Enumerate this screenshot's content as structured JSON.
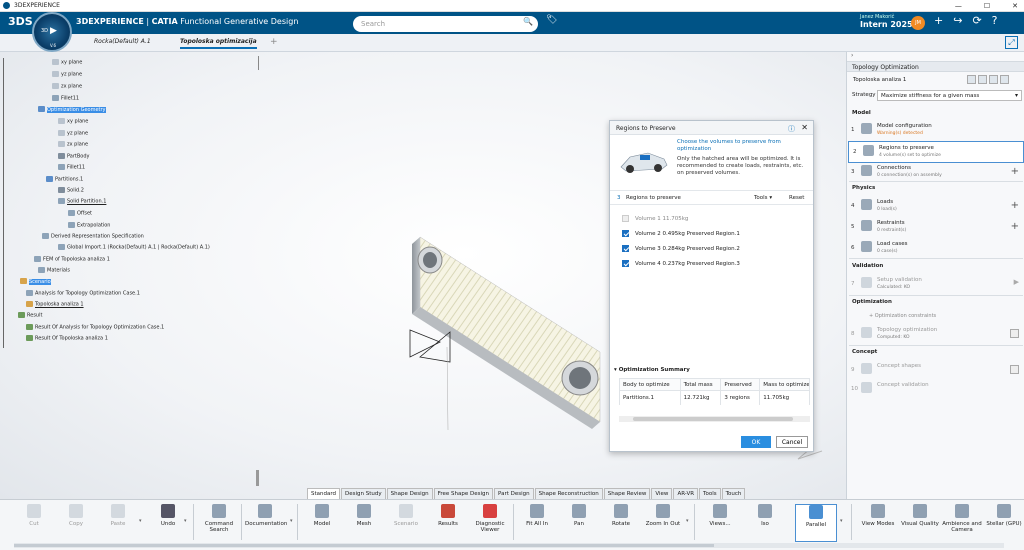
{
  "window": {
    "title": "3DEXPERIENCE",
    "controls": [
      "—",
      "☐",
      "✕"
    ]
  },
  "topbar": {
    "brand_left": "3DEXPERIENCE",
    "brand_sep": " | ",
    "brand_app_bold": "CATIA",
    "brand_app": " Functional Generative Design",
    "search_placeholder": "Search",
    "user_name": "Janez Makorič",
    "tenant": "Intern 2025",
    "avatar_initials": "JM"
  },
  "compass": {
    "label": "3D",
    "version": "V.6"
  },
  "tabs": [
    {
      "label": "Rocka(Default) A.1",
      "active": false
    },
    {
      "label": "Topoloska optimizacija",
      "active": true
    }
  ],
  "tree": [
    {
      "label": "xy plane",
      "icon": "plane"
    },
    {
      "label": "yz plane",
      "icon": "plane"
    },
    {
      "label": "zx plane",
      "icon": "plane"
    },
    {
      "label": "Fillet11",
      "icon": "feature"
    },
    {
      "label": "Optimization Geometry",
      "icon": "geometry",
      "selected": true
    },
    {
      "label": "xy plane",
      "icon": "plane"
    },
    {
      "label": "yz plane",
      "icon": "plane"
    },
    {
      "label": "zx plane",
      "icon": "plane"
    },
    {
      "label": "PartBody",
      "icon": "body"
    },
    {
      "label": "Fillet11",
      "icon": "feature"
    },
    {
      "label": "Partitions.1",
      "icon": "geometry"
    },
    {
      "label": "Solid.2",
      "icon": "body"
    },
    {
      "label": "Solid Partition.1",
      "icon": "feature"
    },
    {
      "label": "Offset",
      "icon": "feature"
    },
    {
      "label": "Extrapolation",
      "icon": "feature"
    },
    {
      "label": "Derived Representation Specification",
      "icon": "feature"
    },
    {
      "label": "Global Import.1 (Rocka(Default) A.1 | Rocka(Default) A.1)",
      "icon": "feature"
    },
    {
      "label": "FEM of Topoloska analiza 1",
      "icon": "feature"
    },
    {
      "label": "Materials",
      "icon": "feature"
    },
    {
      "label": "Scenario",
      "icon": "scenario",
      "selected": true
    },
    {
      "label": "Analysis for Topology Optimization Case.1",
      "icon": "feature"
    },
    {
      "label": "Topoloska analiza 1",
      "icon": "scenario"
    },
    {
      "label": "Result",
      "icon": "result"
    },
    {
      "label": "Result Of Analysis for Topology Optimization Case.1",
      "icon": "result"
    },
    {
      "label": "Result Of Topoloska analiza 1",
      "icon": "result"
    }
  ],
  "dialog": {
    "title": "Regions to Preserve",
    "intro_heading": "Choose the volumes to preserve from optimization",
    "intro_text": "Only the hatched area will be optimized. It is recommended to create loads, restraints, etc. on preserved volumes.",
    "regions_count": "3",
    "regions_label": "Regions to preserve",
    "tools_label": "Tools",
    "reset_label": "Reset",
    "volumes": [
      {
        "label": "Volume 1  11.705kg",
        "checked": false
      },
      {
        "label": "Volume 2  0.495kg   Preserved Region.1",
        "checked": true
      },
      {
        "label": "Volume 3  0.284kg   Preserved Region.2",
        "checked": true
      },
      {
        "label": "Volume 4  0.237kg   Preserved Region.3",
        "checked": true
      }
    ],
    "summary_title": "Optimization Summary",
    "summary_headers": [
      "Body to optimize",
      "Total mass",
      "Preserved",
      "Mass to optimize"
    ],
    "summary_row": [
      "Partitions.1",
      "12.721kg",
      "3 regions",
      "11.705kg"
    ],
    "ok": "OK",
    "cancel": "Cancel"
  },
  "panel": {
    "title": "Topology Optimization",
    "analysis": "Topoloska analiza 1",
    "strategy_label": "Strategy",
    "strategy_value": "Maximize stiffness for a given mass",
    "sections": {
      "model": "Model",
      "physics": "Physics",
      "validation": "Validation",
      "optimization": "Optimization",
      "concept": "Concept"
    },
    "steps": {
      "s1": {
        "num": "1",
        "title": "Model configuration",
        "sub": "Warning(s) detected"
      },
      "s2": {
        "num": "2",
        "title": "Regions to preserve",
        "sub": "4 volume(s) set to optimize"
      },
      "s3": {
        "num": "3",
        "title": "Connections",
        "sub": "0 connection(s) on assembly"
      },
      "s4": {
        "num": "4",
        "title": "Loads",
        "sub": "0 load(s)"
      },
      "s5": {
        "num": "5",
        "title": "Restraints",
        "sub": "0 restraint(s)"
      },
      "s6": {
        "num": "6",
        "title": "Load cases",
        "sub": "0 case(s)"
      },
      "s7": {
        "num": "7",
        "title": "Setup validation",
        "sub": "Calculated: KO"
      },
      "s8": {
        "num": "8",
        "title": "Topology optimization",
        "sub": "Computed: KO"
      },
      "s9": {
        "num": "9",
        "title": "Concept shapes"
      },
      "s10": {
        "num": "10",
        "title": "Concept validation"
      }
    },
    "opt_constraints": "Optimization constraints"
  },
  "section_tabs": [
    "Standard",
    "Design Study",
    "Shape Design",
    "Free Shape Design",
    "Part Design",
    "Shape Reconstruction",
    "Shape Review",
    "View",
    "AR-VR",
    "Tools",
    "Touch"
  ],
  "actions": {
    "cut": "Cut",
    "copy": "Copy",
    "paste": "Paste",
    "undo": "Undo",
    "command_search": "Command Search",
    "documentation": "Documentation",
    "model": "Model",
    "mesh": "Mesh",
    "scenario": "Scenario",
    "results": "Results",
    "diagnostic_viewer": "Diagnostic Viewer",
    "fit_all_in": "Fit All In",
    "pan": "Pan",
    "rotate": "Rotate",
    "zoom_in_out": "Zoom In Out",
    "views": "Views...",
    "iso": "Iso",
    "parallel": "Parallel",
    "view_modes": "View Modes",
    "visual_quality": "Visual Quality",
    "ambience_camera": "Ambience and Camera",
    "stellar": "Stellar (GPU)"
  },
  "colors": {
    "brand": "#005386",
    "accent": "#0a6fb5",
    "selection": "#3a8ee6",
    "warning": "#d9741c"
  }
}
